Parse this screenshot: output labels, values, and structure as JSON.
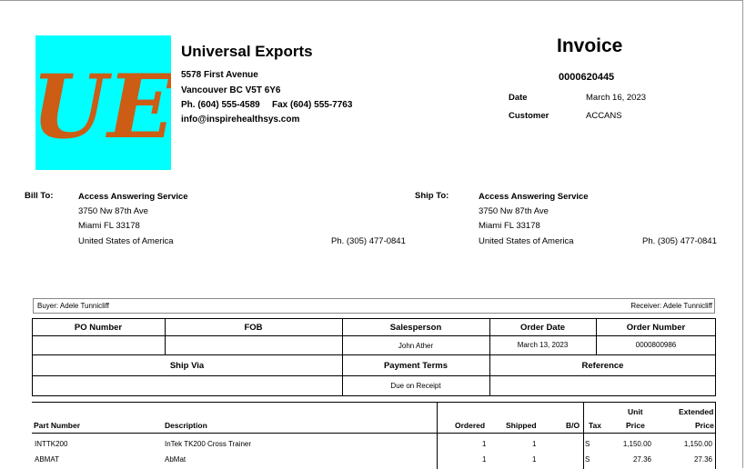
{
  "company": {
    "logo_text": "UE",
    "name": "Universal Exports",
    "address1": "5578 First Avenue",
    "city_line": "Vancouver  BC    V5T 6Y6",
    "phone": "Ph. (604) 555-4589",
    "fax": "Fax (604) 555-7763",
    "email": "info@inspirehealthsys.com"
  },
  "invoice": {
    "title": "Invoice",
    "number": "0000620445",
    "date_label": "Date",
    "date_value": "March  16, 2023",
    "customer_label": "Customer",
    "customer_value": "ACCANS"
  },
  "bill_to": {
    "label": "Bill To:",
    "name": "Access Answering Service",
    "line1": "3750 Nw 87th Ave",
    "line2": "Miami  FL   33178",
    "line3": "United States of America",
    "phone": "Ph. (305) 477-0841"
  },
  "ship_to": {
    "label": "Ship To:",
    "name": "Access Answering Service",
    "line1": "3750 Nw 87th Ave",
    "line2": "Miami  FL   33178",
    "line3": "United States of America",
    "phone": "Ph. (305) 477-0841"
  },
  "order_info": {
    "buyer": "Buyer: Adele Tunnicliff",
    "receiver": "Receiver: Adele Tunnicliff",
    "headers1": {
      "po_number": "PO Number",
      "fob": "FOB",
      "salesperson": "Salesperson",
      "order_date": "Order Date",
      "order_number": "Order Number"
    },
    "values1": {
      "po_number": "",
      "fob": "",
      "salesperson": "John Ather",
      "order_date": "March  13, 2023",
      "order_number": "0000800986"
    },
    "headers2": {
      "ship_via": "Ship Via",
      "payment_terms": "Payment Terms",
      "reference": "Reference"
    },
    "values2": {
      "ship_via": "",
      "payment_terms": "Due on Receipt",
      "reference": ""
    }
  },
  "lines": {
    "headers": {
      "part_number": "Part Number",
      "description": "Description",
      "ordered": "Ordered",
      "shipped": "Shipped",
      "bo": "B/O",
      "tax": "Tax",
      "unit_top": "Unit",
      "unit_bottom": "Price",
      "ext_top": "Extended",
      "ext_bottom": "Price"
    },
    "rows": [
      {
        "part": "INTTK200",
        "description": "InTek TK200 Cross Trainer",
        "ordered": "1",
        "shipped": "1",
        "bo": "",
        "tax": "S",
        "unit": "1,150.00",
        "ext": "1,150.00"
      },
      {
        "part": "ABMAT",
        "description": "AbMat",
        "ordered": "1",
        "shipped": "1",
        "bo": "",
        "tax": "S",
        "unit": "27.36",
        "ext": "27.36"
      }
    ]
  },
  "colors": {
    "logo_bg": "#00ffff",
    "logo_fg": "#cd5c14"
  }
}
